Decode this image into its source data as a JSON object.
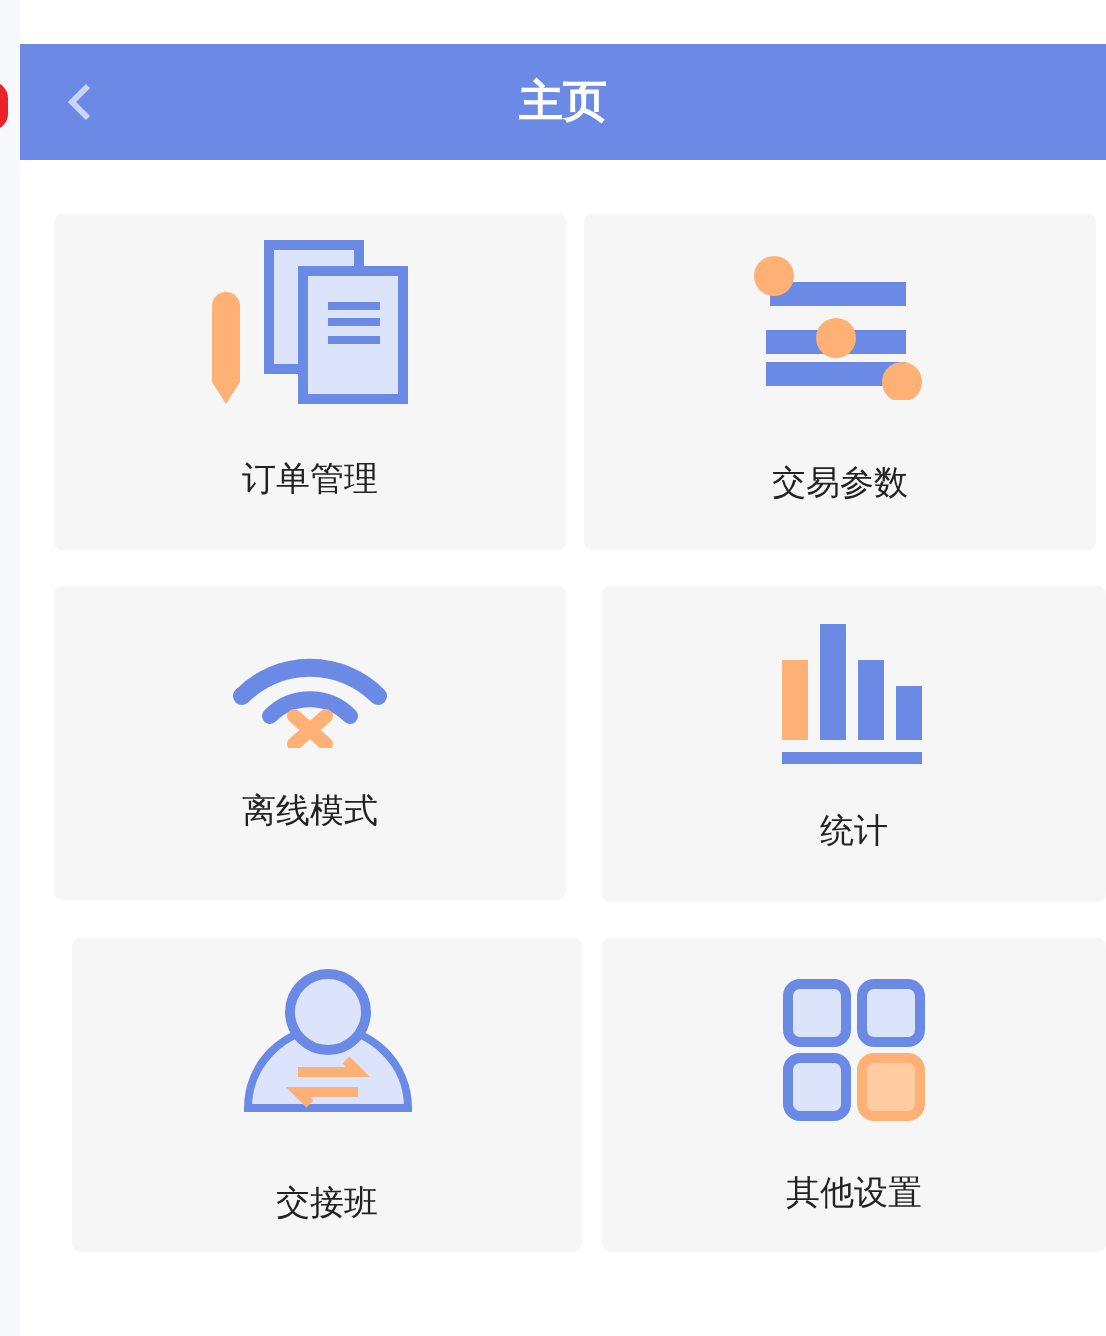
{
  "header": {
    "title": "主页"
  },
  "tiles": [
    {
      "kind": "orders",
      "label": "订单管理"
    },
    {
      "kind": "params",
      "label": "交易参数"
    },
    {
      "kind": "offline",
      "label": "离线模式"
    },
    {
      "kind": "stats",
      "label": "统计"
    },
    {
      "kind": "handover",
      "label": "交接班"
    },
    {
      "kind": "settings",
      "label": "其他设置"
    }
  ]
}
